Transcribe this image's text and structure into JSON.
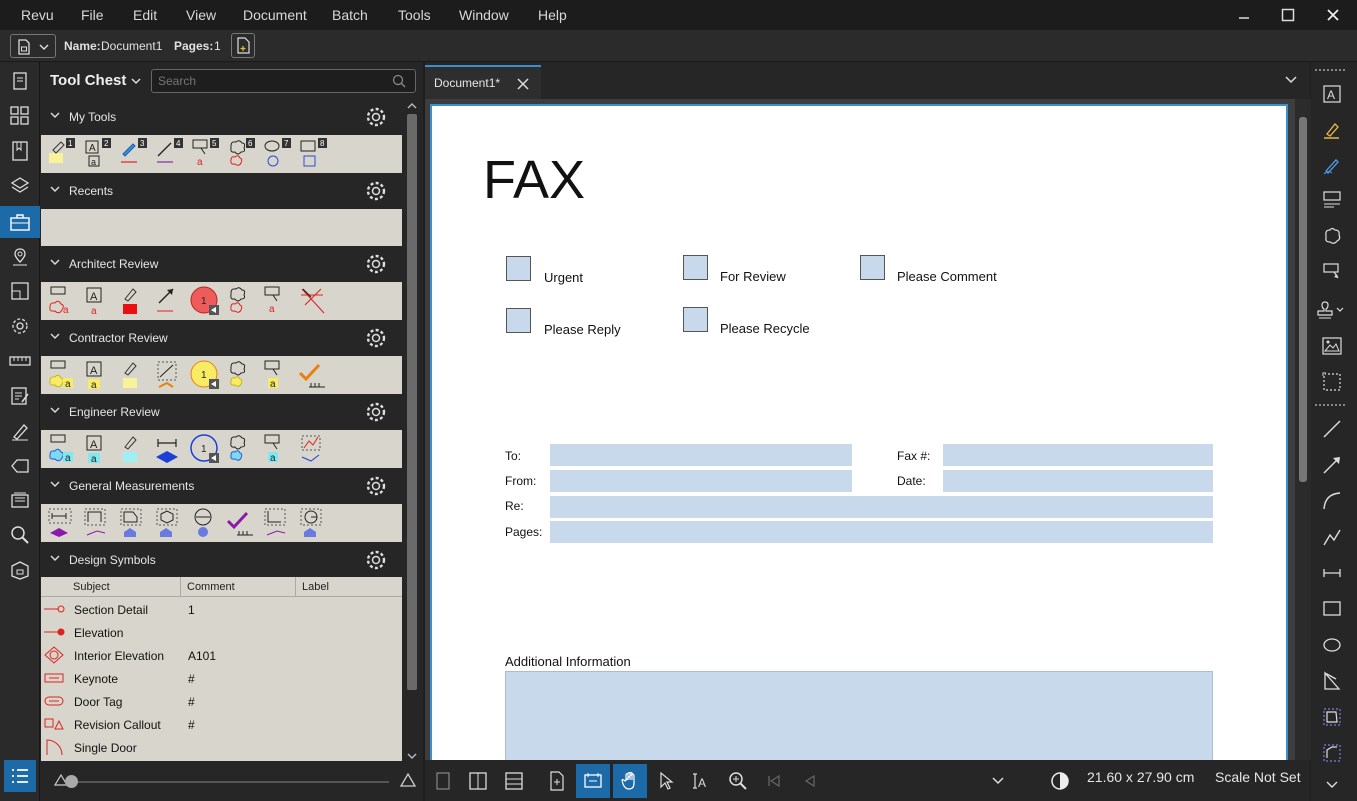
{
  "menubar": {
    "items": [
      "Revu",
      "File",
      "Edit",
      "View",
      "Document",
      "Batch",
      "Tools",
      "Window",
      "Help"
    ]
  },
  "propbar": {
    "name_label": "Name:",
    "name_value": "Document1",
    "pages_label": "Pages:",
    "pages_value": "1"
  },
  "toolchest": {
    "title": "Tool Chest",
    "search_placeholder": "Search",
    "sections": [
      {
        "name": "My Tools"
      },
      {
        "name": "Recents"
      },
      {
        "name": "Architect Review"
      },
      {
        "name": "Contractor Review"
      },
      {
        "name": "Engineer Review"
      },
      {
        "name": "General Measurements"
      },
      {
        "name": "Design Symbols"
      }
    ],
    "my_tools_numbers": [
      "1",
      "2",
      "3",
      "4",
      "5",
      "6",
      "7",
      "8"
    ],
    "design_symbols": {
      "columns": [
        "Subject",
        "Comment",
        "Label"
      ],
      "rows": [
        {
          "subject": "Section Detail",
          "comment": "1"
        },
        {
          "subject": "Elevation",
          "comment": ""
        },
        {
          "subject": "Interior Elevation",
          "comment": "A101"
        },
        {
          "subject": "Keynote",
          "comment": "#"
        },
        {
          "subject": "Door Tag",
          "comment": "#"
        },
        {
          "subject": "Revision Callout",
          "comment": "#"
        },
        {
          "subject": "Single Door",
          "comment": ""
        }
      ]
    }
  },
  "document": {
    "tab_label": "Document1*",
    "fax_title": "FAX",
    "checkboxes": [
      "Urgent",
      "For Review",
      "Please Comment",
      "Please Reply",
      "Please Recycle"
    ],
    "fields": {
      "to": "To:",
      "fax": "Fax #:",
      "from": "From:",
      "date": "Date:",
      "re": "Re:",
      "pages": "Pages:"
    },
    "additional_info": "Additional Information"
  },
  "statusbar": {
    "dimensions": "21.60 x 27.90 cm",
    "scale": "Scale Not Set"
  },
  "colors": {
    "accent": "#1d6aa8",
    "field_fill": "#c9d9ec",
    "tray_bg": "#d8d6cc"
  }
}
